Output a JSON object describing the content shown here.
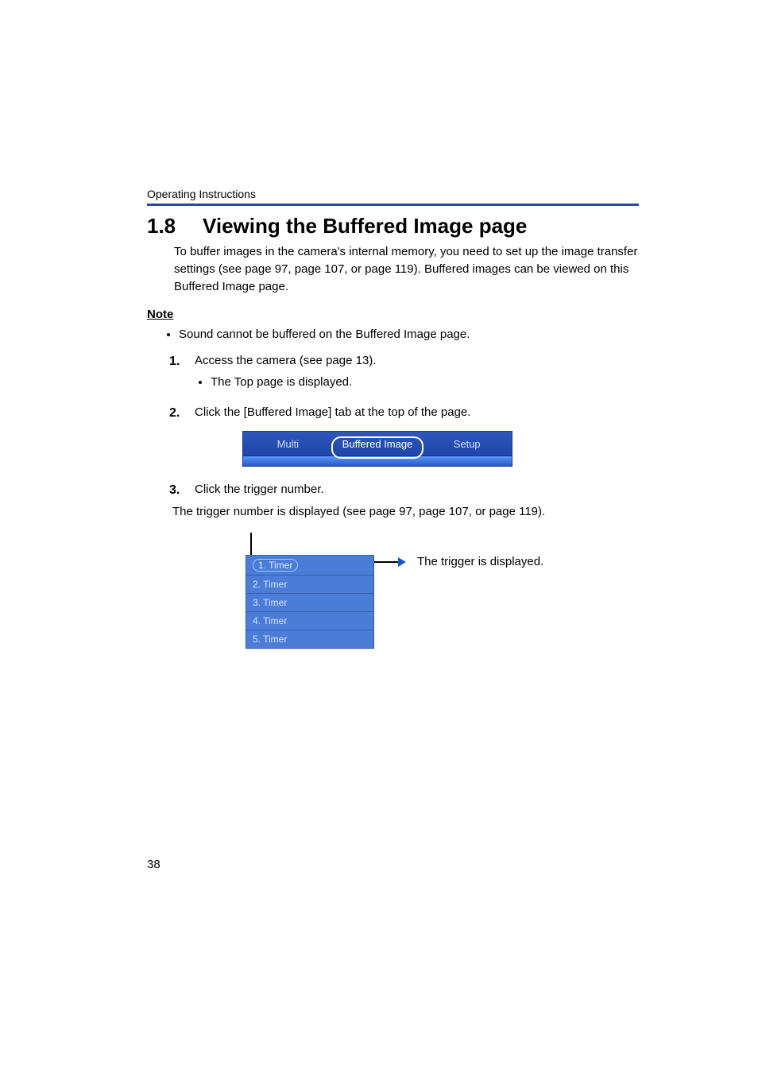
{
  "header": "Operating Instructions",
  "section_number": "1.8",
  "section_title": "Viewing the Buffered Image page",
  "intro": "To buffer images in the camera's internal memory, you need to set up the image transfer settings (see page 97, page 107, or page 119). Buffered images can be viewed on this Buffered Image page.",
  "note_label": "Note",
  "notes": [
    "Sound cannot be buffered on the Buffered Image page."
  ],
  "steps": [
    {
      "num": "1.",
      "text": "Access the camera (see page 13).",
      "sub": [
        "The Top page is displayed."
      ]
    },
    {
      "num": "2.",
      "text": "Click the [Buffered Image] tab at the top of the page."
    },
    {
      "num": "3.",
      "text": "Click the trigger number."
    }
  ],
  "tabs": {
    "items": [
      "Multi",
      "Buffered Image",
      "Setup"
    ],
    "selected_index": 1
  },
  "caption_after_tabs": "The trigger number is displayed (see page 97, page 107, or page 119).",
  "trigger_list": [
    "1. Timer",
    "2. Timer",
    "3. Timer",
    "4. Timer",
    "5. Timer"
  ],
  "callout": "The trigger is displayed.",
  "page_number": "38"
}
